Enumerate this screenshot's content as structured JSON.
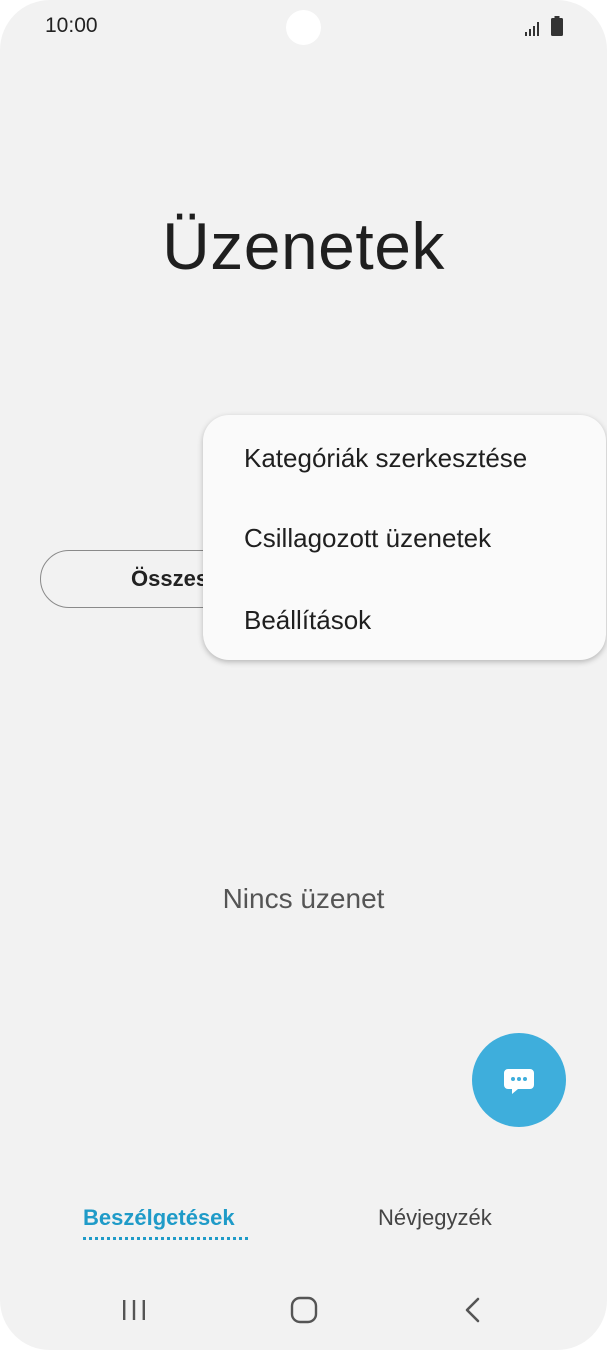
{
  "status_bar": {
    "time": "10:00",
    "icons": [
      "signal-icon",
      "battery-icon"
    ]
  },
  "header": {
    "title": "Üzenetek"
  },
  "filter": {
    "selected_label": "Összes"
  },
  "popup_menu": {
    "items": [
      {
        "label": "Kategóriák szerkesztése"
      },
      {
        "label": "Csillagozott üzenetek"
      },
      {
        "label": "Beállítások"
      }
    ]
  },
  "main": {
    "empty_text": "Nincs üzenet"
  },
  "fab": {
    "icon": "compose-message-icon"
  },
  "tabs": [
    {
      "label": "Beszélgetések",
      "active": true
    },
    {
      "label": "Névjegyzék",
      "active": false
    }
  ],
  "nav_bar": {
    "icons": [
      "recents-icon",
      "home-icon",
      "back-icon"
    ]
  },
  "colors": {
    "accent": "#1f9bc8",
    "fab": "#3eaedc",
    "background": "#f2f2f2"
  }
}
